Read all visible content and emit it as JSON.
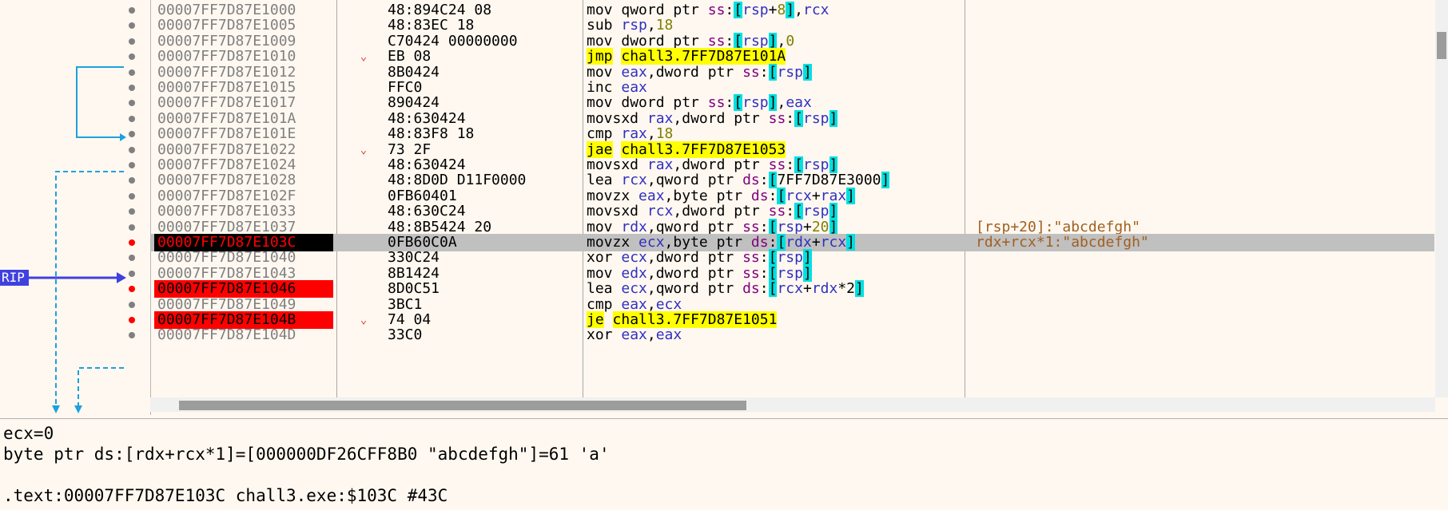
{
  "disassembly": {
    "rows": [
      {
        "address": "00007FF7D87E1000",
        "bytes": "48:894C24 08",
        "mnemonic": "mov",
        "operands": "qword ptr ss:[rsp+8],rcx",
        "comment": ""
      },
      {
        "address": "00007FF7D87E1005",
        "bytes": "48:83EC 18",
        "mnemonic": "sub",
        "operands": "rsp,18",
        "comment": ""
      },
      {
        "address": "00007FF7D87E1009",
        "bytes": "C70424 00000000",
        "mnemonic": "mov",
        "operands": "dword ptr ss:[rsp],0",
        "comment": ""
      },
      {
        "address": "00007FF7D87E1010",
        "bytes": "EB 08",
        "mnemonic": "jmp",
        "operands": "chall3.7FF7D87E101A",
        "comment": ""
      },
      {
        "address": "00007FF7D87E1012",
        "bytes": "8B0424",
        "mnemonic": "mov",
        "operands": "eax,dword ptr ss:[rsp]",
        "comment": ""
      },
      {
        "address": "00007FF7D87E1015",
        "bytes": "FFC0",
        "mnemonic": "inc",
        "operands": "eax",
        "comment": ""
      },
      {
        "address": "00007FF7D87E1017",
        "bytes": "890424",
        "mnemonic": "mov",
        "operands": "dword ptr ss:[rsp],eax",
        "comment": ""
      },
      {
        "address": "00007FF7D87E101A",
        "bytes": "48:630424",
        "mnemonic": "movsxd",
        "operands": "rax,dword ptr ss:[rsp]",
        "comment": ""
      },
      {
        "address": "00007FF7D87E101E",
        "bytes": "48:83F8 18",
        "mnemonic": "cmp",
        "operands": "rax,18",
        "comment": ""
      },
      {
        "address": "00007FF7D87E1022",
        "bytes": "73 2F",
        "mnemonic": "jae",
        "operands": "chall3.7FF7D87E1053",
        "comment": ""
      },
      {
        "address": "00007FF7D87E1024",
        "bytes": "48:630424",
        "mnemonic": "movsxd",
        "operands": "rax,dword ptr ss:[rsp]",
        "comment": ""
      },
      {
        "address": "00007FF7D87E1028",
        "bytes": "48:8D0D D11F0000",
        "mnemonic": "lea",
        "operands": "rcx,qword ptr ds:[7FF7D87E3000]",
        "comment": ""
      },
      {
        "address": "00007FF7D87E102F",
        "bytes": "0FB60401",
        "mnemonic": "movzx",
        "operands": "eax,byte ptr ds:[rcx+rax]",
        "comment": ""
      },
      {
        "address": "00007FF7D87E1033",
        "bytes": "48:630C24",
        "mnemonic": "movsxd",
        "operands": "rcx,dword ptr ss:[rsp]",
        "comment": ""
      },
      {
        "address": "00007FF7D87E1037",
        "bytes": "48:8B5424 20",
        "mnemonic": "mov",
        "operands": "rdx,qword ptr ss:[rsp+20]",
        "comment": "[rsp+20]:\"abcdefgh\""
      },
      {
        "address": "00007FF7D87E103C",
        "bytes": "0FB60C0A",
        "mnemonic": "movzx",
        "operands": "ecx,byte ptr ds:[rdx+rcx]",
        "comment": "rdx+rcx*1:\"abcdefgh\""
      },
      {
        "address": "00007FF7D87E1040",
        "bytes": "330C24",
        "mnemonic": "xor",
        "operands": "ecx,dword ptr ss:[rsp]",
        "comment": ""
      },
      {
        "address": "00007FF7D87E1043",
        "bytes": "8B1424",
        "mnemonic": "mov",
        "operands": "edx,dword ptr ss:[rsp]",
        "comment": ""
      },
      {
        "address": "00007FF7D87E1046",
        "bytes": "8D0C51",
        "mnemonic": "lea",
        "operands": "ecx,qword ptr ds:[rcx+rdx*2]",
        "comment": ""
      },
      {
        "address": "00007FF7D87E1049",
        "bytes": "3BC1",
        "mnemonic": "cmp",
        "operands": "eax,ecx",
        "comment": ""
      },
      {
        "address": "00007FF7D87E104B",
        "bytes": "74 04",
        "mnemonic": "je",
        "operands": "chall3.7FF7D87E1051",
        "comment": ""
      },
      {
        "address": "00007FF7D87E104D",
        "bytes": "33C0",
        "mnemonic": "xor",
        "operands": "eax,eax",
        "comment": ""
      }
    ],
    "rip_label": "RIP"
  },
  "info_pane": {
    "line1": "ecx=0",
    "line2": "byte ptr ds:[rdx+rcx*1]=[000000DF26CFF8B0 \"abcdefgh\"]=61 'a'",
    "line3": "",
    "line4": ".text:00007FF7D87E103C chall3.exe:$103C #43C"
  },
  "colors": {
    "background": "#fff8f0",
    "breakpoint": "#ff0000",
    "current_ip_bg": "#000000",
    "jump_highlight": "#ffff00",
    "bracket_highlight": "#00e0e0",
    "rip_label": "#4040e0",
    "arrow_blue": "#1ea0e0"
  }
}
